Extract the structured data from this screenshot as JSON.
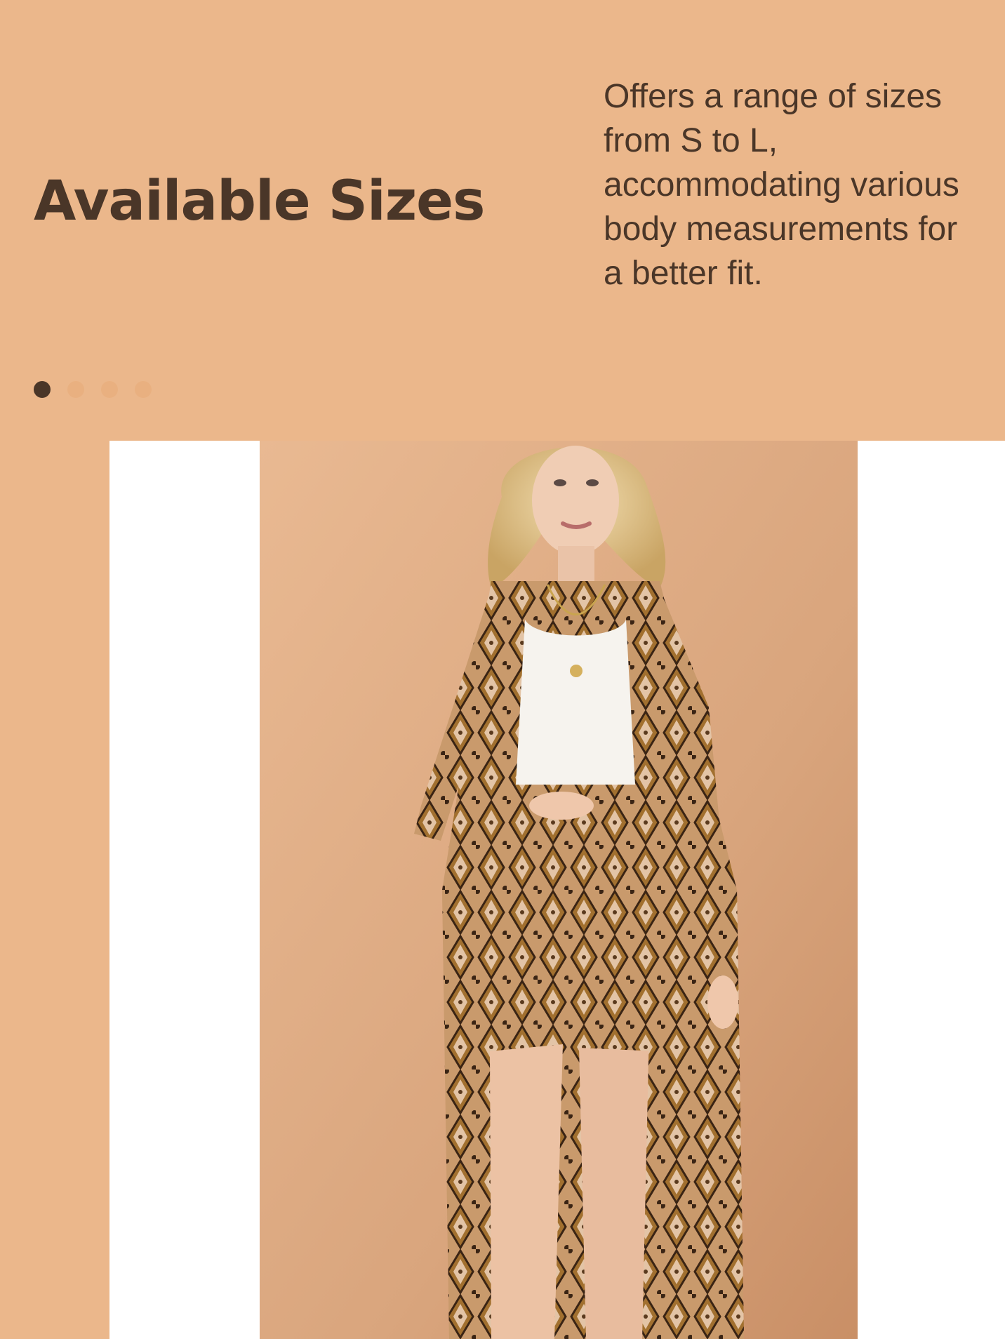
{
  "section": {
    "title": "Available Sizes",
    "description": "Offers a range of sizes from S to L, accommodating various body measurements for a better fit."
  },
  "carousel": {
    "dot_count": 4,
    "active_index": 0
  },
  "colors": {
    "background": "#ebb78b",
    "text": "#4a3628",
    "dot_active": "#4a3628",
    "dot_inactive": "#e9b080",
    "photo_backdrop": "#d8a47c"
  },
  "image": {
    "subject": "model wearing snakeskin-print long cardigan with white tank top and matching shorts"
  }
}
